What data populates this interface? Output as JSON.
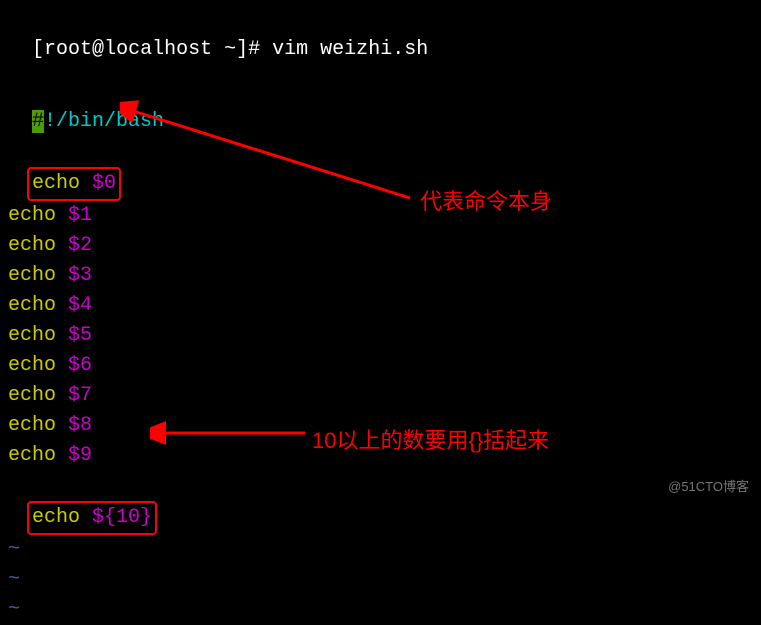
{
  "prompt": {
    "user": "root",
    "host": "localhost",
    "path": "~",
    "symbol": "#",
    "command": "vim weizhi.sh"
  },
  "script": {
    "shebang_hash": "#",
    "shebang_rest": "!/bin/bash",
    "lines": [
      {
        "cmd": "echo",
        "var": "$0"
      },
      {
        "cmd": "echo",
        "var": "$1"
      },
      {
        "cmd": "echo",
        "var": "$2"
      },
      {
        "cmd": "echo",
        "var": "$3"
      },
      {
        "cmd": "echo",
        "var": "$4"
      },
      {
        "cmd": "echo",
        "var": "$5"
      },
      {
        "cmd": "echo",
        "var": "$6"
      },
      {
        "cmd": "echo",
        "var": "$7"
      },
      {
        "cmd": "echo",
        "var": "$8"
      },
      {
        "cmd": "echo",
        "var": "$9"
      },
      {
        "cmd": "echo",
        "var": "${10}"
      }
    ],
    "tilde": "~"
  },
  "annotations": {
    "label1": "代表命令本身",
    "label2": "10以上的数要用{}括起来"
  },
  "watermark": "@51CTO博客"
}
